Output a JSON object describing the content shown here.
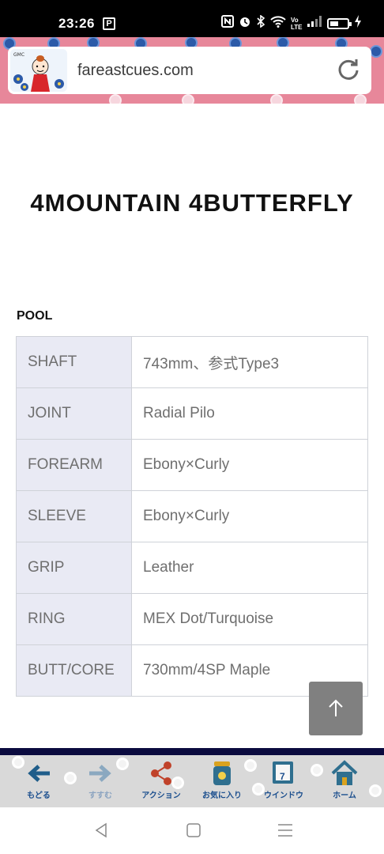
{
  "status_bar": {
    "time": "23:26",
    "notification_letter": "P",
    "icons": [
      "nfc-icon",
      "alarm-icon",
      "bluetooth-icon",
      "wifi-icon",
      "volte-icon",
      "signal-icon",
      "battery-icon",
      "charging-icon"
    ],
    "volte": "Vo LTE"
  },
  "browser": {
    "url": "fareastcues.com"
  },
  "page": {
    "title": "4MOUNTAIN 4BUTTERFLY",
    "section": "POOL",
    "specs": [
      {
        "key": "SHAFT",
        "value": "743mm、参式Type3"
      },
      {
        "key": "JOINT",
        "value": "Radial Pilo"
      },
      {
        "key": "FOREARM",
        "value": "Ebony×Curly"
      },
      {
        "key": "SLEEVE",
        "value": "Ebony×Curly"
      },
      {
        "key": "GRIP",
        "value": "Leather"
      },
      {
        "key": "RING",
        "value": "MEX Dot/Turquoise"
      },
      {
        "key": "BUTT/CORE",
        "value": "730mm/4SP Maple"
      }
    ]
  },
  "toolbar": {
    "back": "もどる",
    "forward": "すすむ",
    "action": "アクション",
    "favorites": "お気に入り",
    "window": "ウインドウ",
    "window_count": "7",
    "home": "ホーム"
  },
  "colors": {
    "header_pink": "#e7879a",
    "table_key_bg": "#e9eaf4",
    "toolbar_label": "#1c4f8e",
    "divider": "#0b0b3f"
  }
}
